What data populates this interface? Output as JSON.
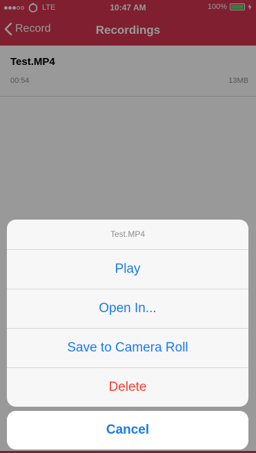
{
  "status_bar": {
    "carrier": "LTE",
    "time": "10:47 AM",
    "battery_percent": "100%",
    "signal_bars_filled": 3,
    "signal_bars_total": 5
  },
  "nav": {
    "back_label": "Record",
    "title": "Recordings"
  },
  "recordings": [
    {
      "title": "Test.MP4",
      "duration": "00:54",
      "size": "13MB"
    }
  ],
  "action_sheet": {
    "title": "Test.MP4",
    "buttons": [
      {
        "label": "Play",
        "style": "default"
      },
      {
        "label": "Open In...",
        "style": "default"
      },
      {
        "label": "Save to Camera Roll",
        "style": "default"
      },
      {
        "label": "Delete",
        "style": "destructive"
      }
    ],
    "cancel_label": "Cancel"
  },
  "colors": {
    "brand": "#d53550",
    "action_blue": "#1a7af2",
    "destructive_red": "#ff3b30"
  },
  "icons": {
    "back": "chevron-left-icon",
    "app": "app-status-icon",
    "battery": "battery-icon",
    "charging": "charging-bolt-icon"
  }
}
